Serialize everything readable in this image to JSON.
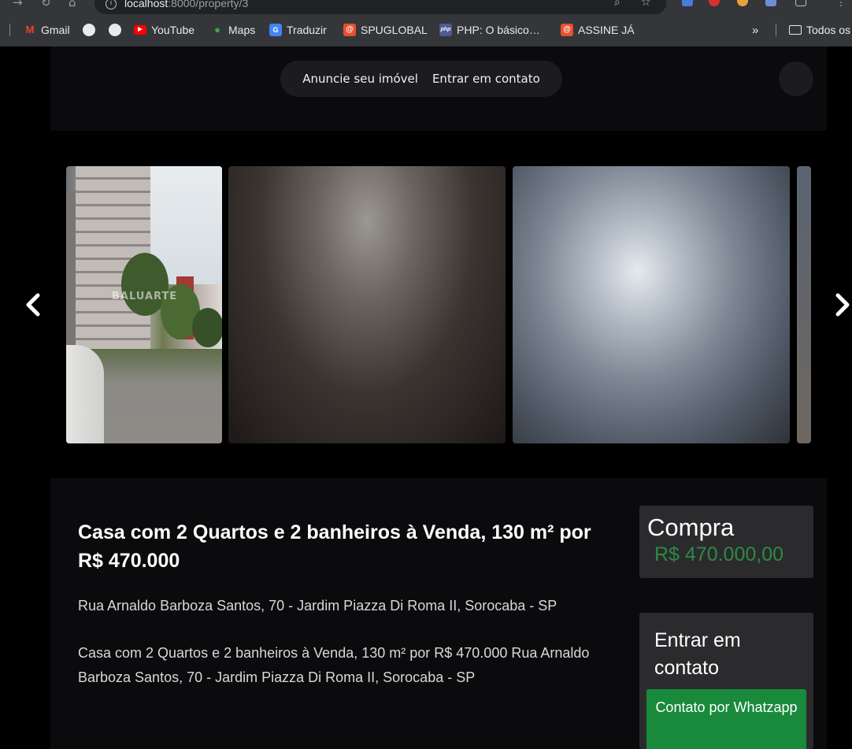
{
  "browser": {
    "url_host": "localhost",
    "url_path": ":8000/property/3",
    "bookmarks": [
      {
        "label": "Gmail",
        "icon": "gmail-icon"
      },
      {
        "label": "",
        "icon": "globe-icon"
      },
      {
        "label": "",
        "icon": "globe-icon"
      },
      {
        "label": "YouTube",
        "icon": "youtube-icon"
      },
      {
        "label": "Maps",
        "icon": "maps-icon"
      },
      {
        "label": "Traduzir",
        "icon": "translate-icon"
      },
      {
        "label": "SPUGLOBAL",
        "icon": "spuglobal-icon"
      },
      {
        "label": "PHP: O básico…",
        "icon": "php-icon"
      },
      {
        "label": "ASSINE JÁ",
        "icon": "assine-icon"
      }
    ],
    "overflow": "»",
    "all_bookmarks": "Todos os"
  },
  "header": {
    "nav": [
      {
        "label": "Anuncie seu imóvel"
      },
      {
        "label": "Entrar em contato"
      }
    ],
    "theme_toggle_icon": "moon-icon"
  },
  "gallery": {
    "watermark": "BALUARTE",
    "prev_icon": "chevron-left-icon",
    "next_icon": "chevron-right-icon"
  },
  "property": {
    "title": "Casa com 2 Quartos e 2 banheiros à Venda, 130 m² por R$ 470.000",
    "address": "Rua Arnaldo Barboza Santos, 70 - Jardim Piazza Di Roma II, Sorocaba - SP",
    "description": "Casa com 2 Quartos e 2 banheiros à Venda, 130 m² por R$ 470.000 Rua Arnaldo Barboza Santos, 70 - Jardim Piazza Di Roma II, Sorocaba - SP"
  },
  "pricing": {
    "label": "Compra",
    "value": "R$ 470.000,00"
  },
  "contact": {
    "title": "Entrar em contato",
    "whatsapp_button": "Contato por Whatzapp"
  },
  "colors": {
    "price_green": "#2d8a45",
    "button_green": "#198a3c",
    "card_bg": "#2b2b2e",
    "section_bg": "#0b0b0d"
  }
}
